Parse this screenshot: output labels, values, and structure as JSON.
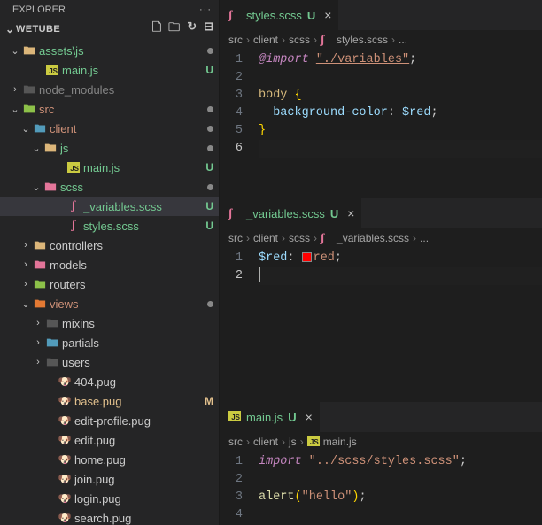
{
  "explorer": {
    "title": "EXPLORER"
  },
  "project": {
    "name": "WETUBE"
  },
  "tree": {
    "assetsjs": "assets\\js",
    "mainjs": "main.js",
    "node_modules": "node_modules",
    "src": "src",
    "client": "client",
    "js": "js",
    "mainjs2": "main.js",
    "scss": "scss",
    "varscss": "_variables.scss",
    "stylesscss": "styles.scss",
    "controllers": "controllers",
    "models": "models",
    "routers": "routers",
    "views": "views",
    "mixins": "mixins",
    "partials": "partials",
    "users": "users",
    "f404": "404.pug",
    "base": "base.pug",
    "editprofile": "edit-profile.pug",
    "edit": "edit.pug",
    "home": "home.pug",
    "join": "join.pug",
    "login": "login.pug",
    "search": "search.pug"
  },
  "git": {
    "U": "U",
    "M": "M"
  },
  "pane1": {
    "tab": {
      "name": "styles.scss",
      "status": "U"
    },
    "crumbs": [
      "src",
      "client",
      "scss",
      "styles.scss",
      "..."
    ],
    "code": {
      "l1": {
        "n": "1",
        "a": "@import",
        "b": " ",
        "c": "\"./variables\"",
        "d": ";"
      },
      "l2": {
        "n": "2"
      },
      "l3": {
        "n": "3",
        "a": "body",
        "b": " {"
      },
      "l4": {
        "n": "4",
        "pad": "  ",
        "a": "background-color",
        "b": ": ",
        "c": "$red",
        "d": ";"
      },
      "l5": {
        "n": "5",
        "a": "}"
      },
      "l6": {
        "n": "6"
      }
    }
  },
  "pane2": {
    "tab": {
      "name": "_variables.scss",
      "status": "U"
    },
    "crumbs": [
      "src",
      "client",
      "scss",
      "_variables.scss",
      "..."
    ],
    "code": {
      "l1": {
        "n": "1",
        "a": "$red",
        "b": ": ",
        "c": "red",
        "d": ";"
      },
      "l2": {
        "n": "2"
      }
    }
  },
  "pane3": {
    "tab": {
      "name": "main.js",
      "status": "U"
    },
    "crumbs": [
      "src",
      "client",
      "js",
      "main.js"
    ],
    "code": {
      "l1": {
        "n": "1",
        "a": "import",
        "b": " ",
        "c": "\"../scss/styles.scss\"",
        "d": ";"
      },
      "l2": {
        "n": "2"
      },
      "l3": {
        "n": "3",
        "a": "alert",
        "b": "(",
        "c": "\"hello\"",
        "d": ")",
        "e": ";"
      },
      "l4": {
        "n": "4"
      }
    }
  }
}
